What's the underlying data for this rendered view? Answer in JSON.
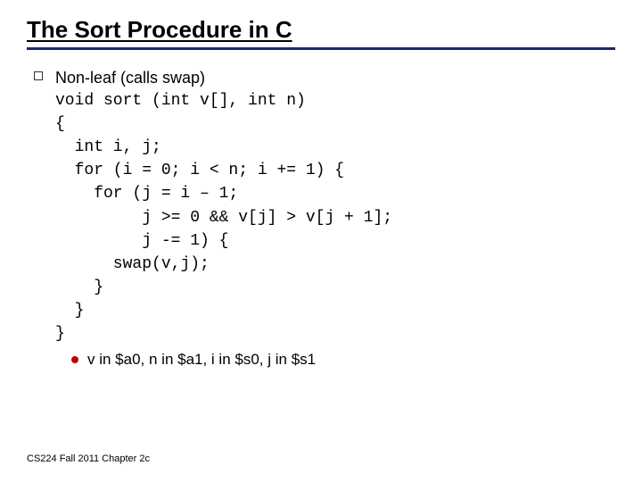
{
  "title": "The Sort Procedure in C",
  "lead": "Non-leaf (calls swap)",
  "code": "void sort (int v[], int n)\n{\n  int i, j;\n  for (i = 0; i < n; i += 1) {\n    for (j = i – 1;\n         j >= 0 && v[j] > v[j + 1];\n         j -= 1) {\n      swap(v,j);\n    }\n  }\n}",
  "sub": "v in $a0, n in $a1, i in $s0, j in $s1",
  "footer": "CS224 Fall 2011 Chapter 2c"
}
